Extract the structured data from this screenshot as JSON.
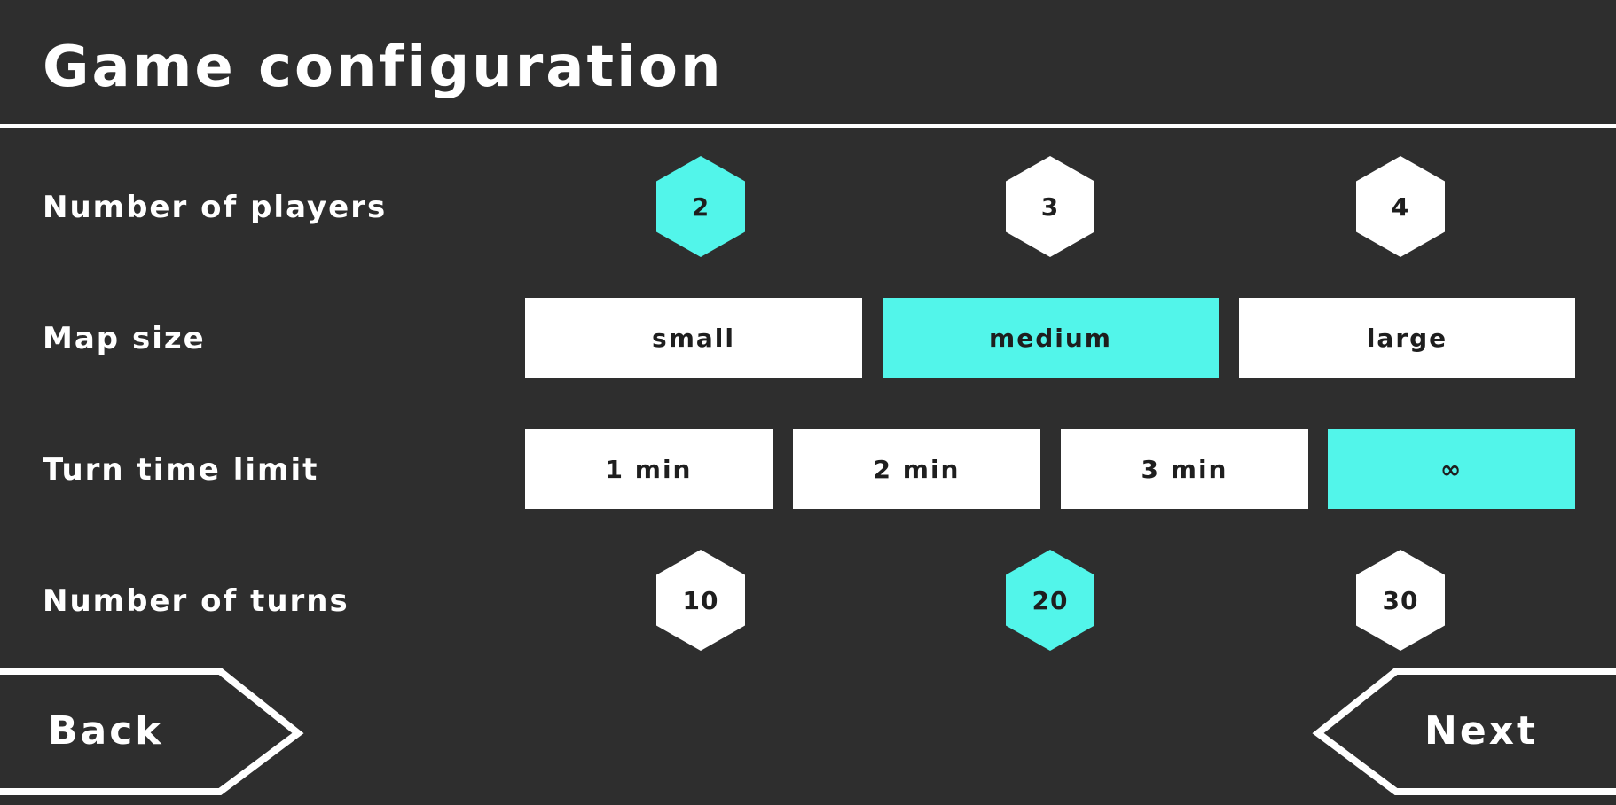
{
  "title": "Game configuration",
  "rows": {
    "players": {
      "label": "Number of players",
      "options": [
        "2",
        "3",
        "4"
      ],
      "selected": "2"
    },
    "map_size": {
      "label": "Map size",
      "options": [
        "small",
        "medium",
        "large"
      ],
      "selected": "medium"
    },
    "turn_time": {
      "label": "Turn time limit",
      "options": [
        "1 min",
        "2 min",
        "3 min",
        "∞"
      ],
      "selected": "∞"
    },
    "turns": {
      "label": "Number of turns",
      "options": [
        "10",
        "20",
        "30"
      ],
      "selected": "20"
    }
  },
  "nav": {
    "back_label": "Back",
    "next_label": "Next"
  },
  "colors": {
    "background": "#2e2e2e",
    "accent": "#52f5ea",
    "foreground": "#ffffff",
    "option_text": "#1e1e1e"
  }
}
